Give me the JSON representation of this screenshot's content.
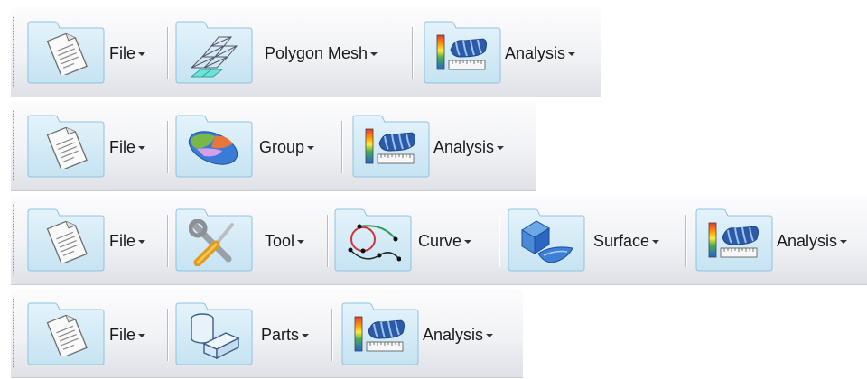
{
  "toolbars": [
    {
      "id": "mesh",
      "buttons": [
        {
          "label": "File",
          "icon": "document-icon"
        },
        {
          "label": "Polygon Mesh",
          "icon": "polygon-mesh-icon"
        },
        {
          "label": "Analysis",
          "icon": "analysis-icon"
        }
      ]
    },
    {
      "id": "group",
      "buttons": [
        {
          "label": "File",
          "icon": "document-icon"
        },
        {
          "label": "Group",
          "icon": "group-icon"
        },
        {
          "label": "Analysis",
          "icon": "analysis-icon"
        }
      ]
    },
    {
      "id": "cad",
      "buttons": [
        {
          "label": "File",
          "icon": "document-icon"
        },
        {
          "label": "Tool",
          "icon": "wrench-screwdriver-icon"
        },
        {
          "label": "Curve",
          "icon": "curve-icon"
        },
        {
          "label": "Surface",
          "icon": "surface-icon"
        },
        {
          "label": "Analysis",
          "icon": "analysis-icon"
        }
      ]
    },
    {
      "id": "parts",
      "buttons": [
        {
          "label": "File",
          "icon": "document-icon"
        },
        {
          "label": "Parts",
          "icon": "parts-icon"
        },
        {
          "label": "Analysis",
          "icon": "analysis-icon"
        }
      ]
    }
  ],
  "colors": {
    "folder": "#d3ebf7",
    "folder_border": "#8fc3de",
    "label": "#1a1a1a"
  }
}
